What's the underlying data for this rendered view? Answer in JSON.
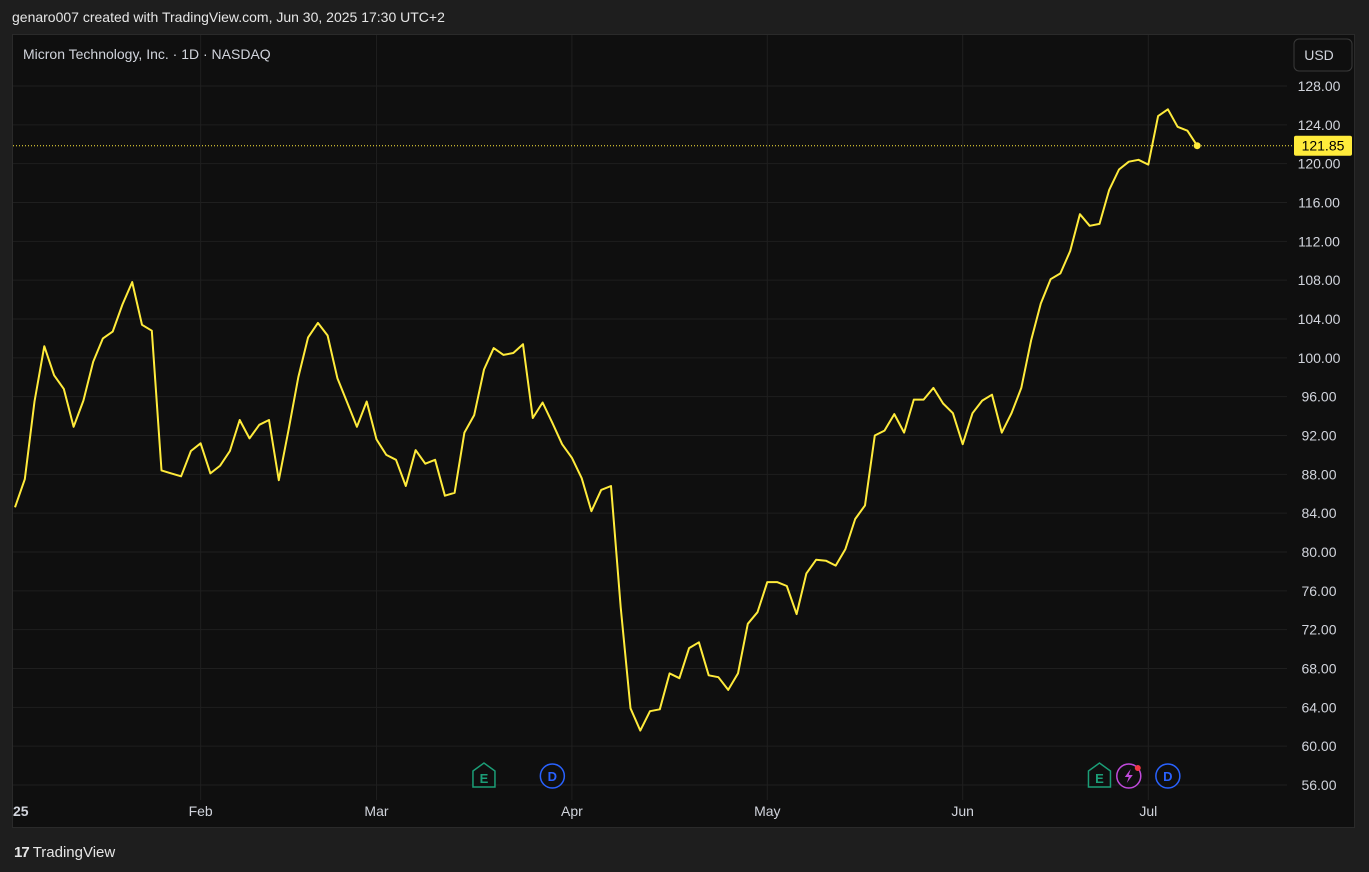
{
  "header": {
    "attribution": "genaro007 created with TradingView.com, Jun 30, 2025 17:30 UTC+2"
  },
  "footer": {
    "logo_glyph": "17",
    "brand": "TradingView"
  },
  "colors": {
    "line": "#ffeb3b",
    "background": "#0f0f0f",
    "grid": "#1f1f1f",
    "axis_text": "#d1d4dc",
    "earnings": "#1b9e77",
    "dividend": "#2962ff",
    "split_event": "#c04adb"
  },
  "chart_data": {
    "type": "line",
    "title": "Micron Technology, Inc. · 1D · NASDAQ",
    "currency": "USD",
    "last_price": "121.85",
    "ylim": [
      54,
      132
    ],
    "y_ticks": [
      56,
      60,
      64,
      68,
      72,
      76,
      80,
      84,
      88,
      92,
      96,
      100,
      104,
      108,
      112,
      116,
      120,
      124,
      128
    ],
    "y_tick_labels": [
      "56.00",
      "60.00",
      "64.00",
      "68.00",
      "72.00",
      "76.00",
      "80.00",
      "84.00",
      "88.00",
      "92.00",
      "96.00",
      "100.00",
      "104.00",
      "108.00",
      "112.00",
      "116.00",
      "120.00",
      "124.00",
      "128.00"
    ],
    "x_tick_labels": [
      {
        "label": "25",
        "index": 0
      },
      {
        "label": "Feb",
        "index": 19
      },
      {
        "label": "Mar",
        "index": 37
      },
      {
        "label": "Apr",
        "index": 57
      },
      {
        "label": "May",
        "index": 77
      },
      {
        "label": "Jun",
        "index": 97
      },
      {
        "label": "Jul",
        "index": 116
      }
    ],
    "grid": true,
    "series": [
      {
        "values": [
          84.6,
          87.5,
          95.5,
          101.2,
          98.2,
          96.8,
          92.9,
          95.6,
          99.6,
          102.0,
          102.7,
          105.5,
          107.8,
          103.4,
          102.8,
          88.4,
          88.1,
          87.8,
          90.4,
          91.2,
          88.1,
          88.9,
          90.4,
          93.6,
          91.7,
          93.1,
          93.6,
          87.4,
          92.6,
          98.0,
          102.1,
          103.6,
          102.3,
          97.9,
          95.4,
          92.9,
          95.5,
          91.6,
          90.0,
          89.5,
          86.8,
          90.5,
          89.1,
          89.5,
          85.8,
          86.1,
          92.3,
          94.1,
          98.8,
          101.0,
          100.3,
          100.5,
          101.4,
          93.8,
          95.4,
          93.3,
          91.1,
          89.7,
          87.6,
          84.2,
          86.4,
          86.8,
          74.3,
          63.9,
          61.6,
          63.6,
          63.8,
          67.5,
          67.0,
          70.1,
          70.7,
          67.3,
          67.1,
          65.8,
          67.5,
          72.6,
          73.8,
          76.9,
          76.9,
          76.5,
          73.6,
          77.8,
          79.2,
          79.1,
          78.6,
          80.3,
          83.4,
          84.8,
          92.0,
          92.5,
          94.2,
          92.3,
          95.7,
          95.7,
          96.9,
          95.3,
          94.3,
          91.1,
          94.3,
          95.6,
          96.2,
          92.3,
          94.3,
          96.9,
          101.8,
          105.6,
          108.1,
          108.7,
          111.0,
          114.8,
          113.6,
          113.8,
          117.3,
          119.4,
          120.2,
          120.4,
          119.9,
          124.9,
          125.6,
          123.8,
          123.4,
          121.85
        ]
      }
    ],
    "events": [
      {
        "type": "E",
        "index": 48
      },
      {
        "type": "D",
        "index": 55
      },
      {
        "type": "E",
        "index": 111
      },
      {
        "type": "split",
        "index": 114
      },
      {
        "type": "D",
        "index": 118
      }
    ]
  }
}
